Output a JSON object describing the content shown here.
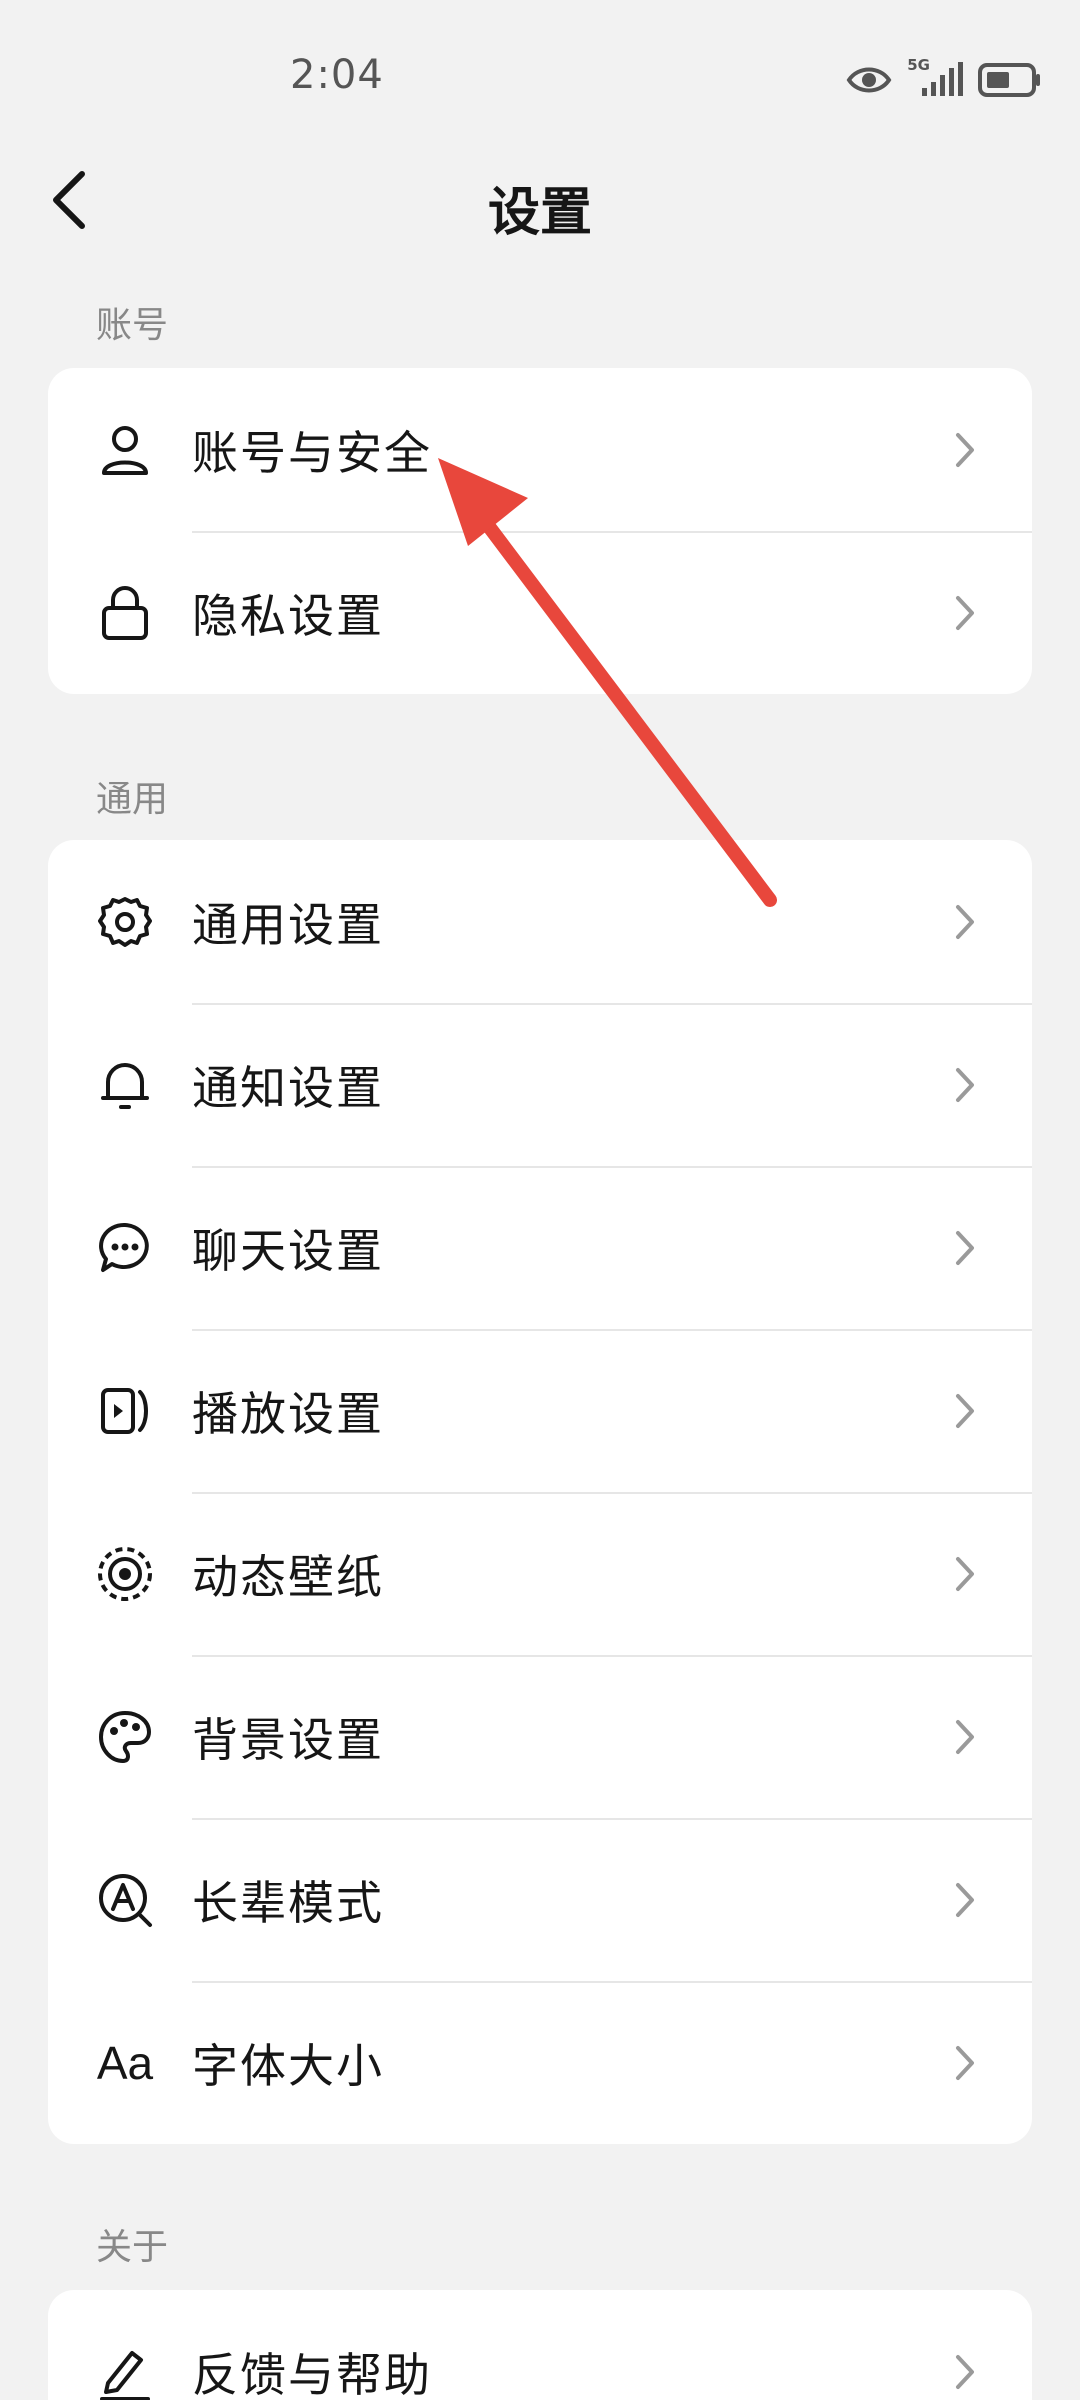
{
  "status_bar": {
    "time": "2:04",
    "network": "5G",
    "icons": [
      "eye-icon",
      "signal-icon",
      "battery-icon"
    ]
  },
  "header": {
    "title": "设置",
    "back_icon": "chevron-left-icon"
  },
  "sections": [
    {
      "label": "账号",
      "items": [
        {
          "label": "账号与安全",
          "icon": "person-icon"
        },
        {
          "label": "隐私设置",
          "icon": "lock-icon"
        }
      ]
    },
    {
      "label": "通用",
      "items": [
        {
          "label": "通用设置",
          "icon": "gear-icon"
        },
        {
          "label": "通知设置",
          "icon": "bell-icon"
        },
        {
          "label": "聊天设置",
          "icon": "chat-bubble-icon"
        },
        {
          "label": "播放设置",
          "icon": "play-icon"
        },
        {
          "label": "动态壁纸",
          "icon": "live-wallpaper-icon"
        },
        {
          "label": "背景设置",
          "icon": "palette-icon"
        },
        {
          "label": "长辈模式",
          "icon": "elder-mode-icon"
        },
        {
          "label": "字体大小",
          "icon": "font-size-icon",
          "glyph": "Aa"
        }
      ]
    },
    {
      "label": "关于",
      "items": [
        {
          "label": "反馈与帮助",
          "icon": "pencil-icon"
        }
      ]
    }
  ],
  "colors": {
    "background": "#f2f2f2",
    "card": "#ffffff",
    "text": "#161616",
    "section_label": "#888888",
    "chevron": "#9a9a9a",
    "annotation_arrow": "#e8473c"
  }
}
